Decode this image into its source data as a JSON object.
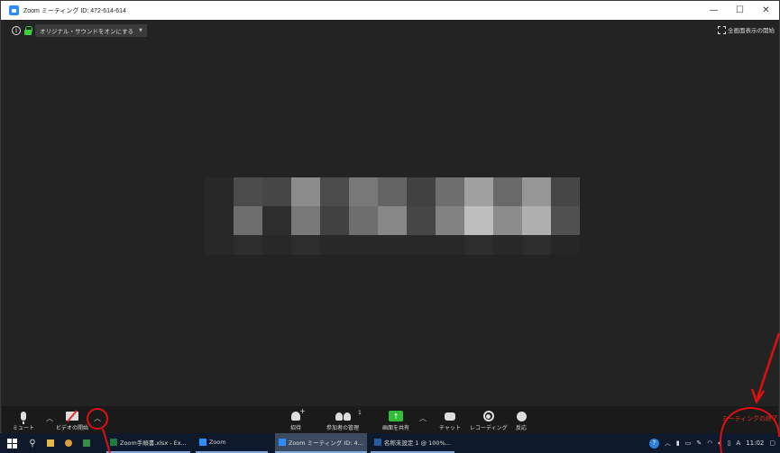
{
  "window": {
    "title": "Zoom ミーティング ID: 472-614-614",
    "controls": [
      "—",
      "☐",
      "✕"
    ]
  },
  "meeting": {
    "sound_button": "オリジナル・サウンドをオンにする",
    "fullscreen": "全画面表示の開始"
  },
  "toolbar": {
    "mute": "ミュート",
    "video": "ビデオの開始",
    "invite": "招待",
    "participants": "参加者の管理",
    "participant_count": "1",
    "share": "画面を共有",
    "chat": "チャット",
    "record": "レコーディング",
    "react": "反応",
    "end": "ミーティングの終了"
  },
  "taskbar": {
    "apps": [
      {
        "label": "Zoom手順書.xlsx - Ex...",
        "color": "#1f7a3f"
      },
      {
        "label": "Zoom",
        "color": "#2d8cff"
      },
      {
        "label": "Zoom ミーティング ID: 4...",
        "color": "#2d8cff"
      },
      {
        "label": "名称未設定 1 @ 100%...",
        "color": "#2c5aa0"
      }
    ],
    "ime": "A",
    "time": "11:02"
  },
  "colors": {
    "accent": "#2d8cff",
    "end": "#e0311f",
    "annotation": "#e01010",
    "share": "#2fbd3a"
  },
  "mosaic": [
    [
      40,
      75,
      70,
      140,
      75,
      120,
      100,
      65,
      110,
      160,
      105,
      150,
      70
    ],
    [
      40,
      110,
      45,
      120,
      65,
      110,
      135,
      70,
      130,
      190,
      140,
      175,
      80
    ],
    [
      40,
      45,
      40,
      45,
      40,
      40,
      40,
      40,
      40,
      45,
      40,
      45,
      38
    ]
  ]
}
